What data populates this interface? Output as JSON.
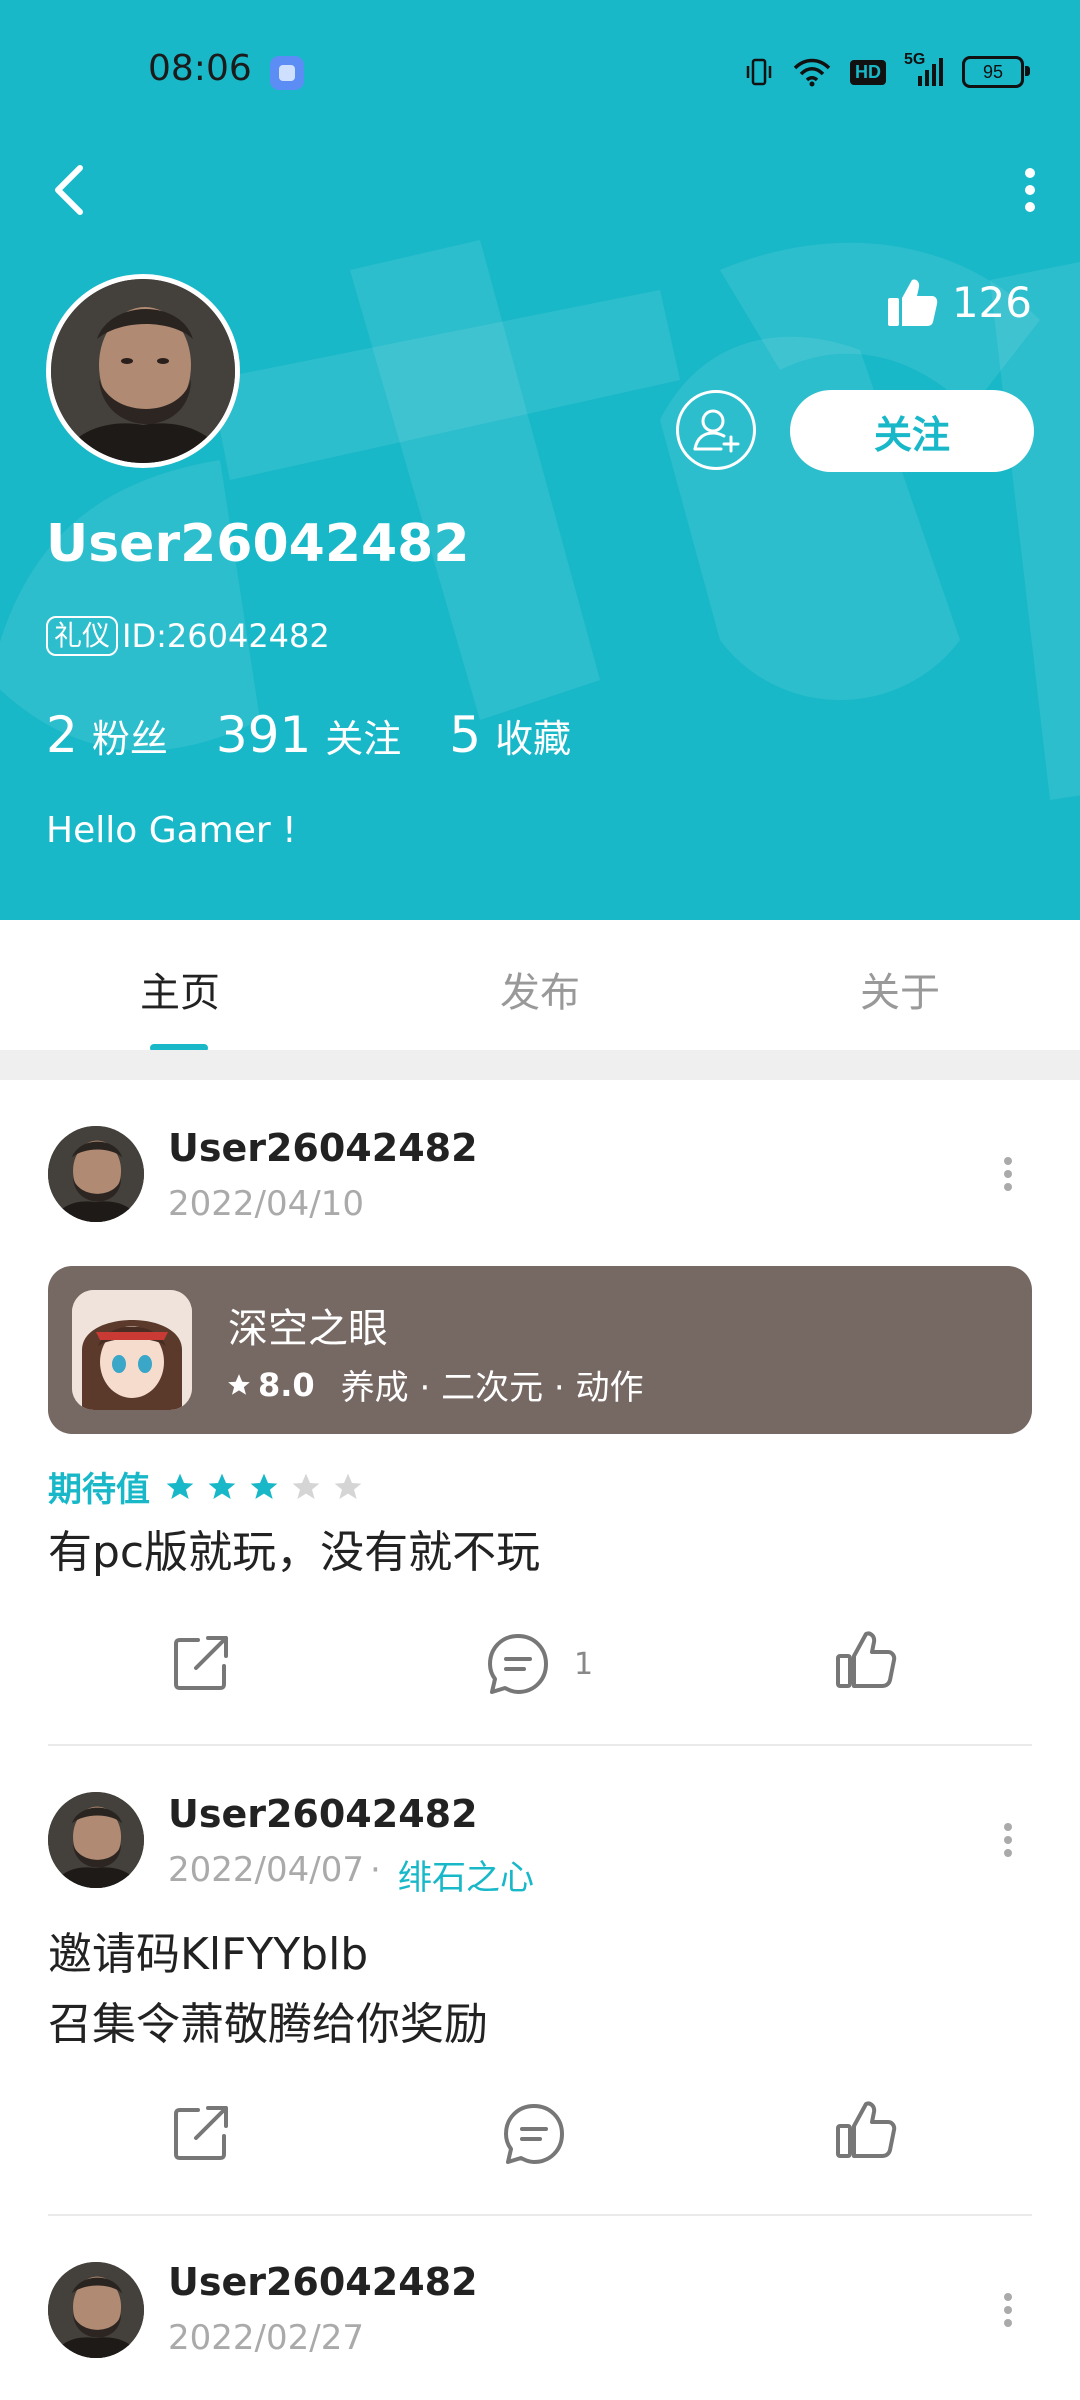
{
  "status_bar": {
    "time": "08:06",
    "hd": "HD",
    "network": "5G",
    "battery": "95"
  },
  "profile": {
    "likes_count": "126",
    "follow_label": "关注",
    "username": "User26042482",
    "badge": "礼仪",
    "id_text": "ID:26042482",
    "stats": [
      {
        "value": "2",
        "label": "粉丝"
      },
      {
        "value": "391",
        "label": "关注"
      },
      {
        "value": "5",
        "label": "收藏"
      }
    ],
    "bio": "Hello Gamer !"
  },
  "tabs": [
    {
      "label": "主页",
      "active": true
    },
    {
      "label": "发布",
      "active": false
    },
    {
      "label": "关于",
      "active": false
    }
  ],
  "posts": [
    {
      "author": "User26042482",
      "date": "2022/04/10",
      "game": {
        "title": "深空之眼",
        "rating": "8.0",
        "tags": "养成 · 二次元 · 动作"
      },
      "rating_label": "期待值",
      "stars": 3,
      "stars_max": 5,
      "text": "有pc版就玩，没有就不玩",
      "comment_count": "1"
    },
    {
      "author": "User26042482",
      "date": "2022/04/07",
      "tag": "绯石之心",
      "text_lines": [
        "邀请码KlFYYblb",
        "召集令萧敬腾给你奖励"
      ]
    },
    {
      "author": "User26042482",
      "date": "2022/02/27"
    }
  ],
  "colors": {
    "accent": "#18b8c9",
    "card": "#766863",
    "muted": "#aaaaaa"
  },
  "icons": [
    "back-icon",
    "more-vertical-icon",
    "thumbs-up-icon",
    "add-user-icon",
    "share-icon",
    "comment-icon",
    "like-icon",
    "star-icon"
  ]
}
